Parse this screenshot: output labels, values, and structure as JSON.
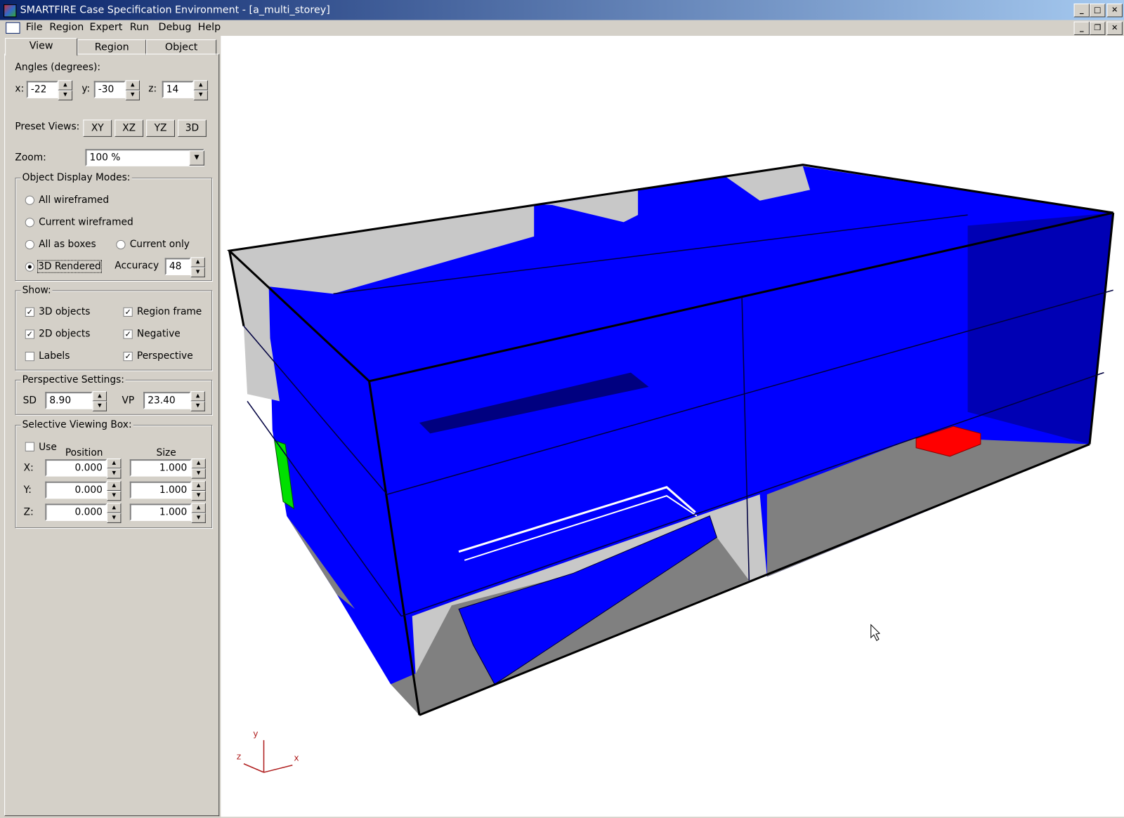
{
  "window": {
    "title": "SMARTFIRE Case Specification Environment - [a_multi_storey]",
    "min": "_",
    "max": "□",
    "close": "✕",
    "restore": "❐"
  },
  "menu": [
    "File",
    "Region",
    "Expert",
    "Run",
    "Debug",
    "Help"
  ],
  "tabs": [
    "View",
    "Region",
    "Object"
  ],
  "view": {
    "angles_label": "Angles (degrees):",
    "x_label": "x:",
    "x": "-22",
    "y_label": "y:",
    "y": "-30",
    "z_label": "z:",
    "z": "14",
    "preset_label": "Preset Views:",
    "presets": [
      "XY",
      "XZ",
      "YZ",
      "3D"
    ],
    "zoom_label": "Zoom:",
    "zoom": "100 %",
    "modes_title": "Object Display Modes:",
    "modes": [
      "All wireframed",
      "Current wireframed",
      "All as boxes",
      "Current only",
      "3D Rendered"
    ],
    "selected_mode": "3D Rendered",
    "accuracy_label": "Accuracy",
    "accuracy": "48",
    "show_title": "Show:",
    "show": [
      {
        "label": "3D objects",
        "checked": true
      },
      {
        "label": "Region frame",
        "checked": true
      },
      {
        "label": "2D objects",
        "checked": true
      },
      {
        "label": "Negative",
        "checked": true
      },
      {
        "label": "Labels",
        "checked": false
      },
      {
        "label": "Perspective",
        "checked": true
      }
    ],
    "perspective_title": "Perspective Settings:",
    "sd_label": "SD",
    "sd": "8.90",
    "vp_label": "VP",
    "vp": "23.40",
    "svb_title": "Selective Viewing Box:",
    "use_label": "Use",
    "use_checked": false,
    "position_label": "Position",
    "size_label": "Size",
    "rows": [
      {
        "axis": "X:",
        "pos": "0.000",
        "size": "1.000"
      },
      {
        "axis": "Y:",
        "pos": "0.000",
        "size": "1.000"
      },
      {
        "axis": "Z:",
        "pos": "0.000",
        "size": "1.000"
      }
    ]
  },
  "scene": {
    "axes": {
      "x": "x",
      "y": "y",
      "z": "z"
    },
    "colors": {
      "walls": "#0000ff",
      "dark_walls": "#0000b4",
      "floor": "#808080",
      "back": "#c8c8c8",
      "fire": "#ff0000",
      "vent": "#00e000",
      "axes": "#b02020"
    }
  }
}
